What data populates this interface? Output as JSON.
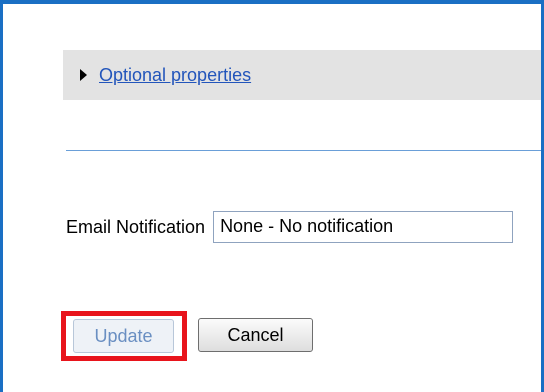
{
  "optional_section": {
    "link_label": "Optional properties"
  },
  "email_notification": {
    "label": "Email Notification",
    "selected_value": "None - No notification"
  },
  "actions": {
    "update_label": "Update",
    "cancel_label": "Cancel"
  },
  "colors": {
    "frame_border": "#1a6fc4",
    "highlight": "#e8141c",
    "link": "#2255bb"
  }
}
